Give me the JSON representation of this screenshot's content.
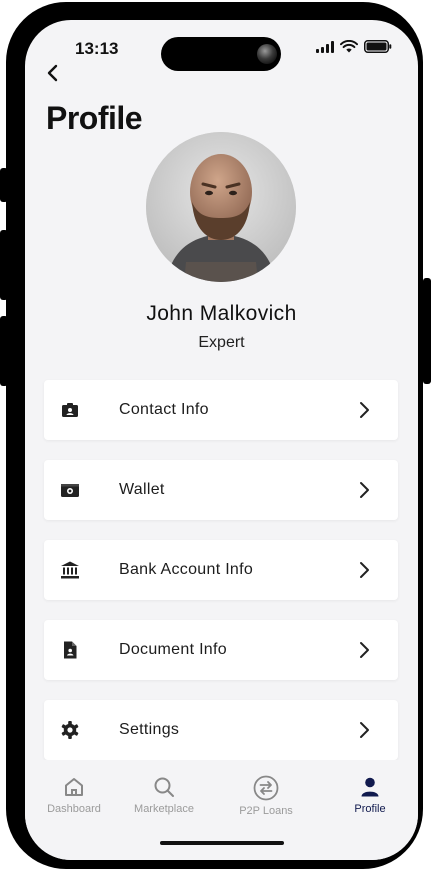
{
  "status_bar": {
    "time": "13:13"
  },
  "header": {
    "title": "Profile"
  },
  "user": {
    "name": "John Malkovich",
    "role": "Expert"
  },
  "menu": [
    {
      "label": "Contact Info",
      "icon": "contact-badge-icon"
    },
    {
      "label": "Wallet",
      "icon": "wallet-icon"
    },
    {
      "label": "Bank Account Info",
      "icon": "bank-icon"
    },
    {
      "label": "Document Info",
      "icon": "document-icon"
    },
    {
      "label": "Settings",
      "icon": "gear-icon"
    }
  ],
  "tabs": [
    {
      "label": "Dashboard",
      "icon": "home-icon",
      "active": false
    },
    {
      "label": "Marketplace",
      "icon": "search-icon",
      "active": false
    },
    {
      "label": "P2P Loans",
      "icon": "swap-icon",
      "active": false
    },
    {
      "label": "Profile",
      "icon": "person-icon",
      "active": true
    }
  ],
  "colors": {
    "active_tab": "#111a4e",
    "inactive_tab": "#9b9b9b",
    "background": "#f4f4f6"
  }
}
